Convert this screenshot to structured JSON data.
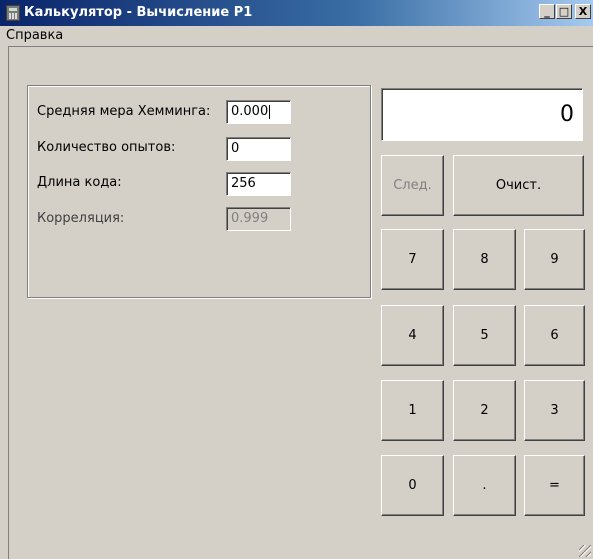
{
  "window": {
    "title": "Калькулятор - Вычисление Р1",
    "minimize": "_",
    "maximize": "□",
    "close": "X"
  },
  "menu": {
    "items": [
      "Справка"
    ]
  },
  "panel": {
    "fields": [
      {
        "label": "Средняя мера Хемминга:",
        "value": "0.000",
        "disabled": false
      },
      {
        "label": "Количество опытов:",
        "value": "0",
        "disabled": false
      },
      {
        "label": "Длина кода:",
        "value": "256",
        "disabled": false
      },
      {
        "label": "Корреляция:",
        "value": "0.999",
        "disabled": true
      }
    ]
  },
  "display": {
    "value": "0"
  },
  "buttons": {
    "next": "След.",
    "clear": "Очист.",
    "keys": [
      "7",
      "8",
      "9",
      "4",
      "5",
      "6",
      "1",
      "2",
      "3",
      "0",
      ".",
      "="
    ]
  }
}
